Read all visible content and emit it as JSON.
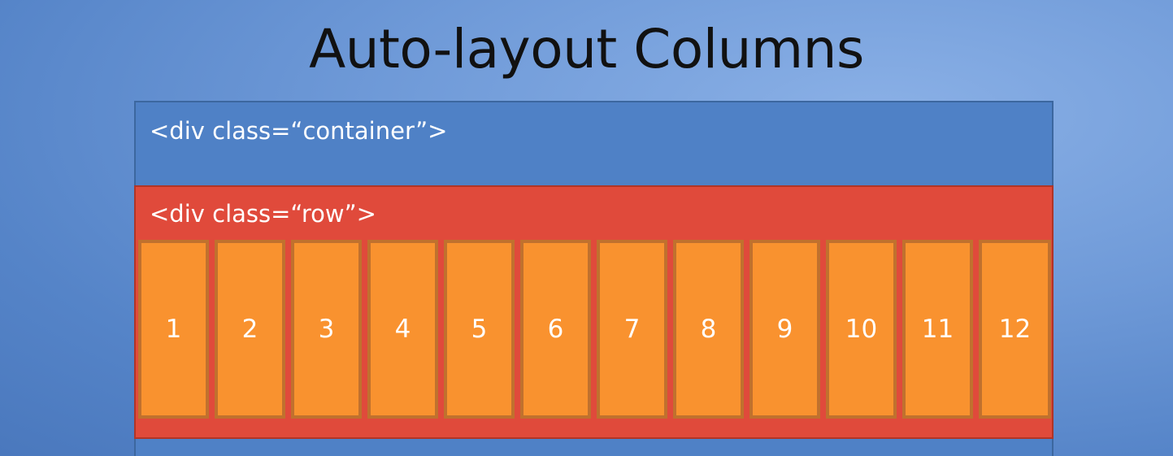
{
  "slide": {
    "title": "Auto-layout Columns"
  },
  "container": {
    "label": "<div class=“container”>"
  },
  "row": {
    "label": "<div class=“row”>"
  },
  "columns": [
    "1",
    "2",
    "3",
    "4",
    "5",
    "6",
    "7",
    "8",
    "9",
    "10",
    "11",
    "12"
  ],
  "colors": {
    "container": "#4f81c6",
    "row": "#e04a3b",
    "column": "#f9922f",
    "column_border": "#c0712e"
  }
}
